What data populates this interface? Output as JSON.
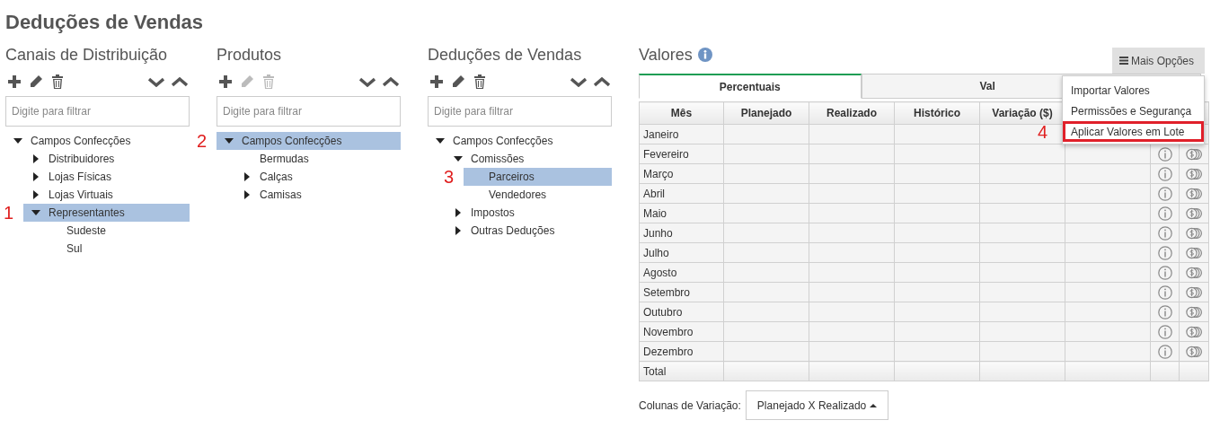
{
  "page_title": "Deduções de Vendas",
  "panels": [
    {
      "title": "Canais de Distribuição",
      "toolbar": {
        "edit_enabled": true,
        "delete_enabled": true
      },
      "filter": {
        "placeholder": "Digite para filtrar"
      },
      "tree": [
        {
          "label": "Campos Confecções",
          "expanded": true,
          "selected": false,
          "children": [
            {
              "label": "Distribuidores",
              "expanded": false,
              "selected": false
            },
            {
              "label": "Lojas Físicas",
              "expanded": false,
              "selected": false
            },
            {
              "label": "Lojas Virtuais",
              "expanded": false,
              "selected": false
            },
            {
              "label": "Representantes",
              "expanded": true,
              "selected": true,
              "callout": "1",
              "children": [
                {
                  "label": "Sudeste",
                  "selected": false
                },
                {
                  "label": "Sul",
                  "selected": false
                }
              ]
            }
          ]
        }
      ]
    },
    {
      "title": "Produtos",
      "toolbar": {
        "edit_enabled": false,
        "delete_enabled": false
      },
      "filter": {
        "placeholder": "Digite para filtrar"
      },
      "tree": [
        {
          "label": "Campos Confecções",
          "expanded": true,
          "selected": true,
          "callout": "2",
          "children": [
            {
              "label": "Bermudas",
              "selected": false
            },
            {
              "label": "Calças",
              "expanded": false,
              "selected": false
            },
            {
              "label": "Camisas",
              "expanded": false,
              "selected": false
            }
          ]
        }
      ]
    },
    {
      "title": "Deduções de Vendas",
      "toolbar": {
        "edit_enabled": true,
        "delete_enabled": true
      },
      "filter": {
        "placeholder": "Digite para filtrar"
      },
      "tree": [
        {
          "label": "Campos Confecções",
          "expanded": true,
          "selected": false,
          "children": [
            {
              "label": "Comissões",
              "expanded": true,
              "selected": false,
              "children": [
                {
                  "label": "Parceiros",
                  "selected": true,
                  "callout": "3"
                },
                {
                  "label": "Vendedores",
                  "selected": false
                }
              ]
            },
            {
              "label": "Impostos",
              "expanded": false,
              "selected": false
            },
            {
              "label": "Outras Deduções",
              "expanded": false,
              "selected": false
            }
          ]
        }
      ]
    }
  ],
  "values": {
    "title": "Valores",
    "more_button": "Mais Opções",
    "menu": [
      {
        "label": "Importar Valores",
        "highlighted": false
      },
      {
        "label": "Permissões e Segurança",
        "highlighted": false
      },
      {
        "label": "Aplicar Valores em Lote",
        "highlighted": true,
        "callout": "4"
      }
    ],
    "tabs": [
      {
        "label": "Percentuais",
        "selected": true
      },
      {
        "label": "Val",
        "selected": false
      }
    ],
    "table": {
      "columns": [
        "Mês",
        "Planejado",
        "Realizado",
        "Histórico",
        "Variação ($)"
      ],
      "rows": [
        {
          "month": "Janeiro"
        },
        {
          "month": "Fevereiro",
          "actions": true
        },
        {
          "month": "Março",
          "actions": true
        },
        {
          "month": "Abril",
          "actions": true
        },
        {
          "month": "Maio",
          "actions": true
        },
        {
          "month": "Junho",
          "actions": true
        },
        {
          "month": "Julho",
          "actions": true
        },
        {
          "month": "Agosto",
          "actions": true
        },
        {
          "month": "Setembro",
          "actions": true
        },
        {
          "month": "Outubro",
          "actions": true
        },
        {
          "month": "Novembro",
          "actions": true
        },
        {
          "month": "Dezembro",
          "actions": true
        }
      ],
      "total": "Total"
    },
    "variation": {
      "label": "Colunas de Variação:",
      "value": "Planejado X Realizado"
    }
  }
}
